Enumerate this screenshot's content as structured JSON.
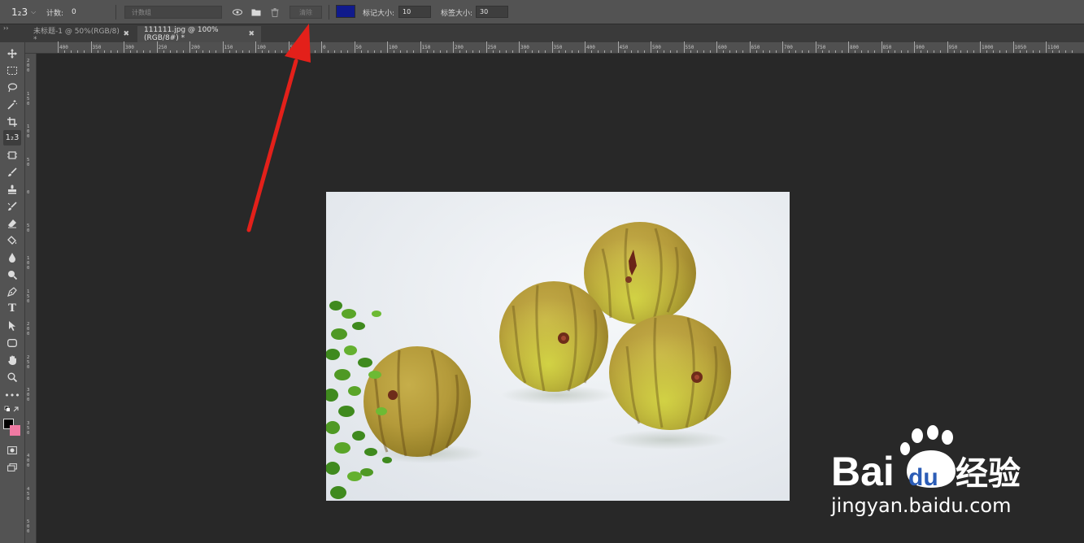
{
  "options_bar": {
    "tool_preset": "1₂3",
    "count_label": "计数:",
    "count_value": "0",
    "count_group_placeholder": "计数组",
    "clear_label": "清除",
    "marker_color": "#101a8c",
    "marker_size_label": "标记大小:",
    "marker_size_value": "10",
    "label_size_label": "标签大小:",
    "label_size_value": "30"
  },
  "tabs": [
    {
      "label": "未标题-1 @ 50%(RGB/8) *",
      "active": false
    },
    {
      "label": "111111.jpg @ 100%(RGB/8#) *",
      "active": true
    }
  ],
  "ruler": {
    "top_labels": [
      "400",
      "350",
      "300",
      "250",
      "200",
      "150",
      "100",
      "50",
      "0",
      "50",
      "100",
      "150",
      "200",
      "250",
      "300",
      "350",
      "400",
      "450",
      "500",
      "550",
      "600",
      "650",
      "700",
      "750",
      "800",
      "850",
      "900",
      "950",
      "1000",
      "1050",
      "1100"
    ],
    "left_labels": [
      "200",
      "150",
      "100",
      "50",
      "0",
      "50",
      "100",
      "150",
      "200",
      "250",
      "300",
      "350",
      "400",
      "450",
      "500"
    ]
  },
  "toolbar": {
    "tools": [
      "move-icon",
      "marquee-icon",
      "lasso-icon",
      "magic-wand-icon",
      "crop-icon",
      "count-tool-icon",
      "frame-icon",
      "brush-icon",
      "stamp-icon",
      "history-brush-icon",
      "eraser-icon",
      "paint-bucket-icon",
      "blur-icon",
      "dodge-icon",
      "pen-icon",
      "type-icon",
      "path-select-icon",
      "shape-icon",
      "hand-icon",
      "zoom-icon",
      "more-icon"
    ],
    "foreground_color": "#000000",
    "background_color": "#f07aa3"
  },
  "watermark": {
    "brand_text": "Bai",
    "brand_text2": "du",
    "brand_cn": "经验",
    "domain": "jingyan.baidu.com"
  }
}
